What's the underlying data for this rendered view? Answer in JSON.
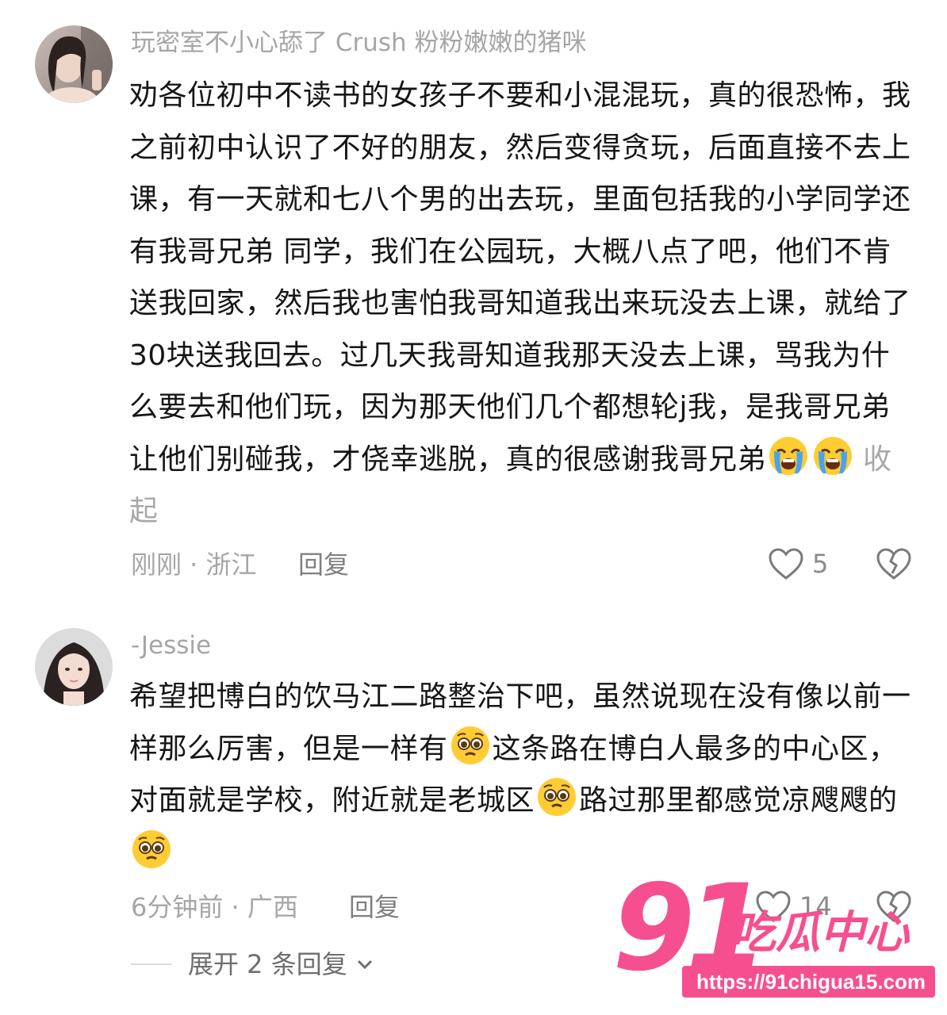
{
  "comments": [
    {
      "username": "玩密室不小心舔了 Crush 粉粉嫩嫩的猪咪",
      "text": "劝各位初中不读书的女孩子不要和小混混玩，真的很恐怖，我之前初中认识了不好的朋友，然后变得贪玩，后面直接不去上课，有一天就和七八个男的出去玩，里面包括我的小学同学还有我哥兄弟 同学，我们在公园玩，大概八点了吧，他们不肯送我回家，然后我也害怕我哥知道我出来玩没去上课，就给了30块送我回去。过几天我哥知道我那天没去上课，骂我为什么要去和他们玩，因为那天他们几个都想轮j我，是我哥兄弟让他们别碰我，才侥幸逃脱，真的很感谢我哥兄弟",
      "collapse_label": "收起",
      "time_location": "刚刚 · 浙江",
      "reply_label": "回复",
      "likes": "5",
      "emojis": [
        "loudly-crying-face",
        "loudly-crying-face"
      ]
    },
    {
      "username": "-Jessie",
      "text_part1": "希望把博白的饮马江二路整治下吧，虽然说现在没有像以前一样那么厉害，但是一样有",
      "text_part2": "这条路在博白人最多的中心区，对面就是学校，附近就是老城区",
      "text_part3": "路过那里都感觉凉飕飕的",
      "time_location": "6分钟前 · 广西",
      "reply_label": "回复",
      "likes": "14",
      "expand_replies_label": "展开 2 条回复",
      "emojis": [
        "pleading-face",
        "pleading-face",
        "pleading-face"
      ]
    }
  ],
  "watermark": {
    "number": "91",
    "name": "吃瓜中心",
    "url": "https://91chigua15.com"
  },
  "colors": {
    "text": "#161616",
    "muted": "#a6a6a6",
    "watermark": "#f64f8f"
  }
}
